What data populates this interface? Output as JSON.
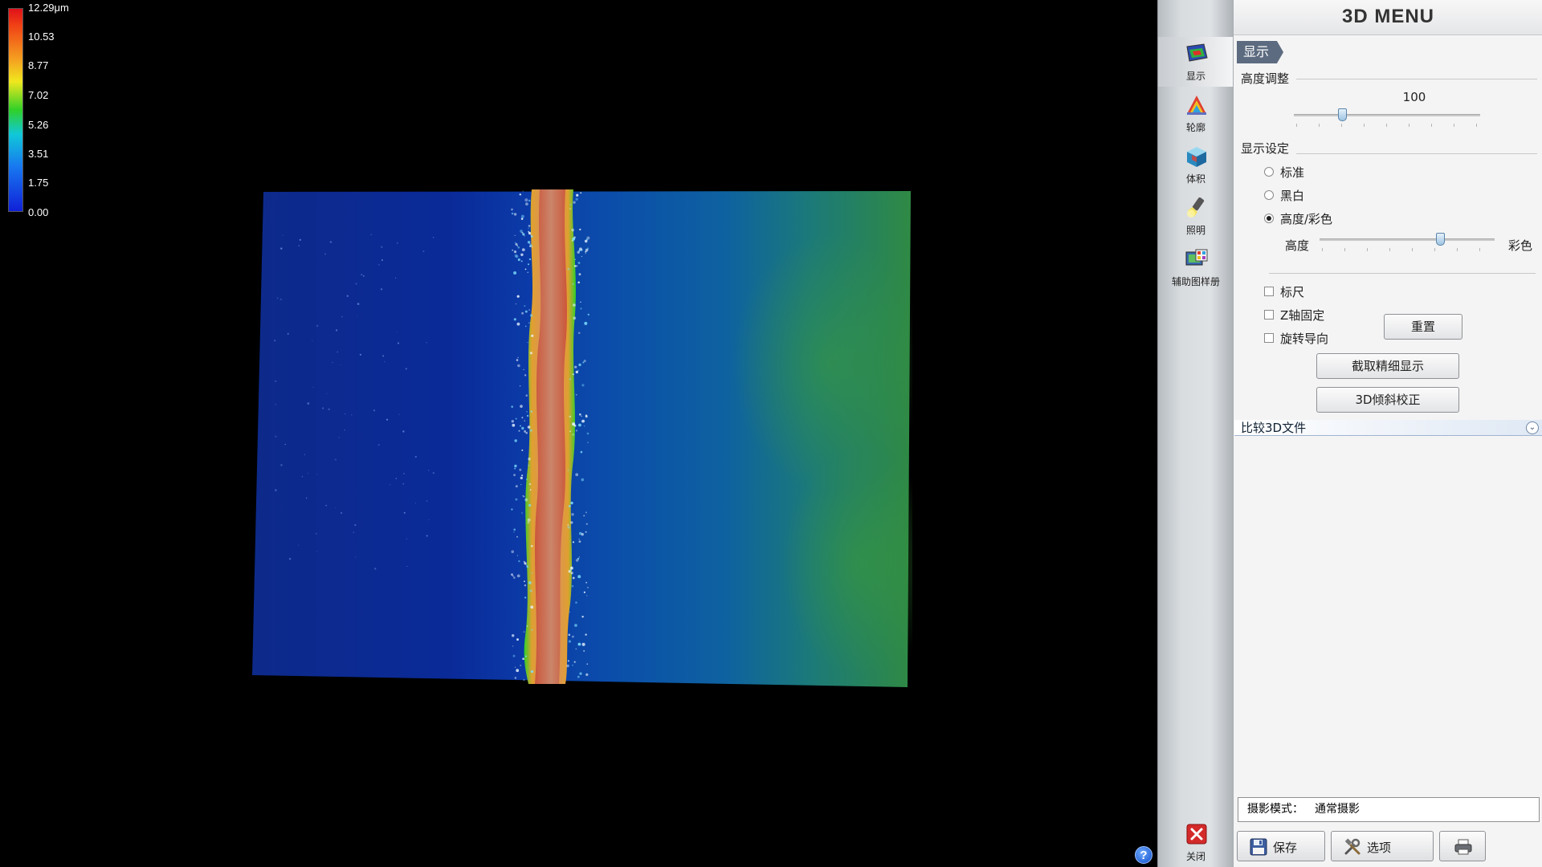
{
  "legend": {
    "labels": [
      "12.29μm",
      "10.53",
      "8.77",
      "7.02",
      "5.26",
      "3.51",
      "1.75",
      "0.00"
    ]
  },
  "toolbar": {
    "items": [
      {
        "label": "显示",
        "icon": "display-surface-icon"
      },
      {
        "label": "轮廓",
        "icon": "profile-icon"
      },
      {
        "label": "体积",
        "icon": "volume-cube-icon"
      },
      {
        "label": "照明",
        "icon": "flashlight-icon"
      },
      {
        "label": "辅助图样册",
        "icon": "image-album-icon"
      }
    ],
    "close_label": "关闭"
  },
  "menu": {
    "title": "3D MENU",
    "tab": "显示",
    "height_adjust": {
      "title": "高度调整",
      "value": "100"
    },
    "display_settings": {
      "title": "显示设定",
      "options": [
        "标准",
        "黑白",
        "高度/彩色"
      ],
      "selected": "高度/彩色",
      "blend_left": "高度",
      "blend_right": "彩色"
    },
    "checkboxes": [
      "标尺",
      "Z轴固定",
      "旋转导向"
    ],
    "reset_button": "重置",
    "capture_button": "截取精细显示",
    "tilt_button": "3D倾斜校正",
    "compare_label": "比较3D文件",
    "mode_label": "摄影模式：",
    "mode_value": "通常摄影",
    "save_label": "保存",
    "options_label": "选项",
    "help_glyph": "?"
  },
  "colors": {
    "low": "#1020d8",
    "mid": "#30d028",
    "high": "#e0101a"
  }
}
